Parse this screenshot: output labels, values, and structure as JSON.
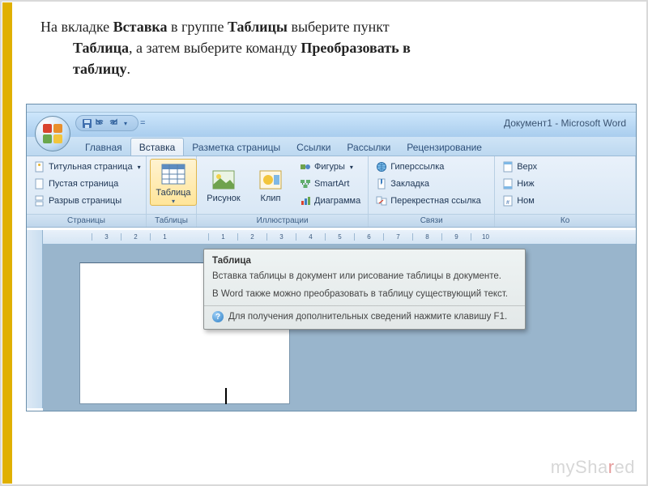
{
  "instruction": {
    "line1_a": "На вкладке ",
    "b1": "Вставка",
    "line1_b": " в группе ",
    "b2": "Таблицы",
    "line1_c": " выберите пункт",
    "b3": "Таблица",
    "line2_a": ", а затем выберите команду ",
    "b4": "Преобразовать в",
    "b5": "таблицу",
    "line2_b": "."
  },
  "window_title": "Документ1 - Microsoft Word",
  "hidden_title": "Документ1     Microsoft",
  "tabs": [
    "Главная",
    "Вставка",
    "Разметка страницы",
    "Ссылки",
    "Рассылки",
    "Рецензирование"
  ],
  "active_tab": 1,
  "groups": {
    "pages": {
      "title": "Страницы",
      "items": [
        "Титульная страница",
        "Пустая страница",
        "Разрыв страницы"
      ]
    },
    "tables": {
      "title": "Таблицы",
      "button": "Таблица"
    },
    "illus": {
      "title": "Иллюстрации",
      "big": [
        "Рисунок",
        "Клип"
      ],
      "small": [
        "Фигуры",
        "SmartArt",
        "Диаграмма"
      ]
    },
    "links": {
      "title": "Связи",
      "items": [
        "Гиперссылка",
        "Закладка",
        "Перекрестная ссылка"
      ]
    },
    "partial": {
      "title": "Ко",
      "items": [
        "Верх",
        "Ниж",
        "Ном"
      ]
    }
  },
  "ruler_marks": [
    "3",
    "2",
    "1",
    "",
    "1",
    "2",
    "3",
    "4",
    "5",
    "6",
    "7",
    "8",
    "9",
    "10"
  ],
  "tooltip": {
    "title": "Таблица",
    "body1": "Вставка таблицы в документ или рисование таблицы в документе.",
    "body2": "В Word также можно преобразовать в таблицу существующий текст.",
    "help": "Для получения дополнительных сведений нажмите клавишу F1."
  },
  "watermark": {
    "a": "mySha",
    "r": "r",
    "b": "ed"
  },
  "icons": {
    "save": "save-icon",
    "undo": "undo-icon",
    "redo": "redo-icon",
    "more": "more-icon",
    "titlepage": "page-star-icon",
    "blankpage": "blank-page-icon",
    "break": "page-break-icon",
    "table": "table-grid-icon",
    "picture": "picture-icon",
    "clip": "clipart-icon",
    "shapes": "shapes-icon",
    "smartart": "smartart-icon",
    "chart": "chart-icon",
    "link": "globe-link-icon",
    "bookmark": "bookmark-icon",
    "xref": "crossref-icon",
    "header": "header-icon",
    "footer": "footer-icon",
    "pagenum": "pagenum-icon"
  }
}
